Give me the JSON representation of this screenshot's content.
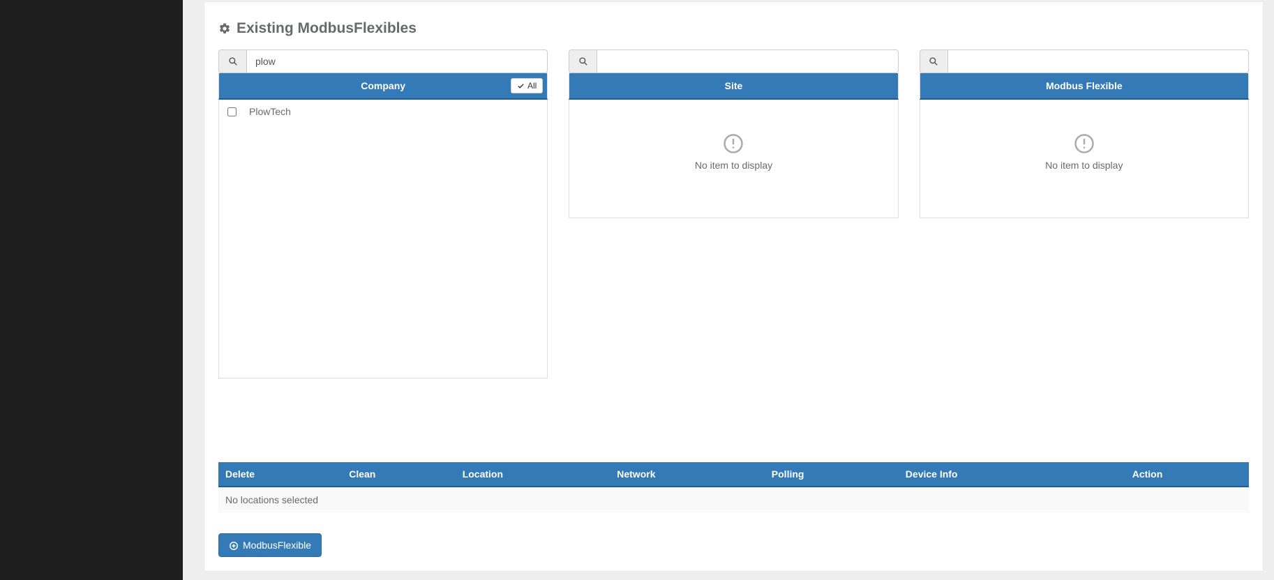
{
  "page": {
    "title": "Existing ModbusFlexibles"
  },
  "columns": {
    "company": {
      "header": "Company",
      "all_label": "All",
      "search_value": "plow",
      "items": [
        {
          "label": "PlowTech"
        }
      ]
    },
    "site": {
      "header": "Site",
      "search_value": "",
      "empty_text": "No item to display"
    },
    "modbus": {
      "header": "Modbus Flexible",
      "search_value": "",
      "empty_text": "No item to display"
    }
  },
  "table": {
    "headers": {
      "delete": "Delete",
      "clean": "Clean",
      "location": "Location",
      "network": "Network",
      "polling": "Polling",
      "device_info": "Device Info",
      "action": "Action"
    },
    "empty_text": "No locations selected"
  },
  "buttons": {
    "add_modbus": "ModbusFlexible"
  }
}
